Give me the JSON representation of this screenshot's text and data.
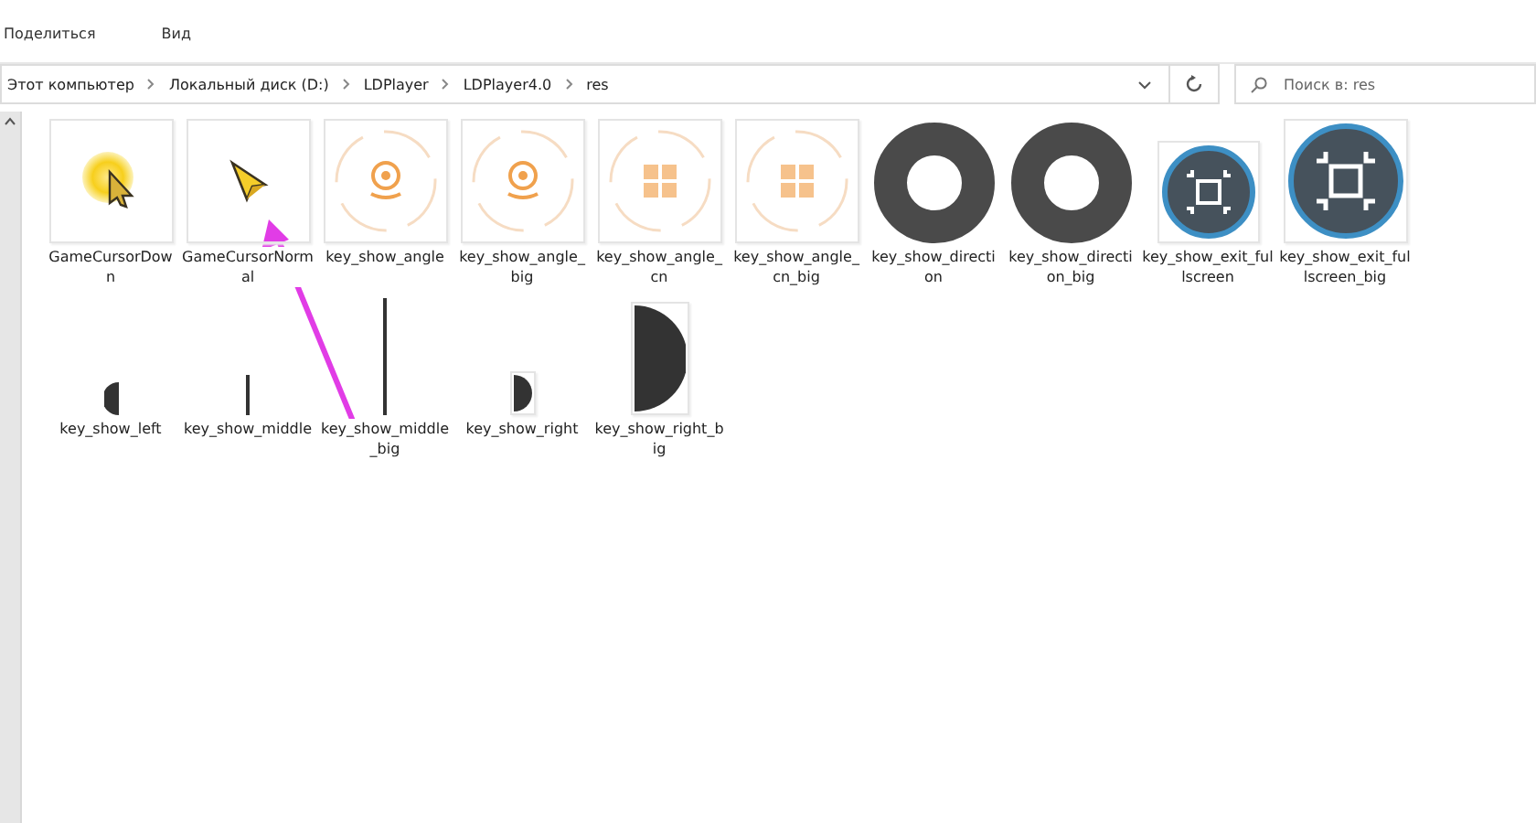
{
  "menu": [
    "Поделиться",
    "Вид"
  ],
  "breadcrumb": [
    "Этот компьютер",
    "Локальный диск (D:)",
    "LDPlayer",
    "LDPlayer4.0",
    "res"
  ],
  "search": {
    "placeholder": "Поиск в: res"
  },
  "files": [
    {
      "name": "GameCursorDown",
      "kind": "cursor-down"
    },
    {
      "name": "GameCursorNormal",
      "kind": "cursor"
    },
    {
      "name": "key_show_angle",
      "kind": "angle"
    },
    {
      "name": "key_show_angle_big",
      "kind": "angle"
    },
    {
      "name": "key_show_angle_cn",
      "kind": "angle-cn"
    },
    {
      "name": "key_show_angle_cn_big",
      "kind": "angle-cn"
    },
    {
      "name": "key_show_direction",
      "kind": "direction"
    },
    {
      "name": "key_show_direction_big",
      "kind": "direction"
    },
    {
      "name": "key_show_exit_fullscreen",
      "kind": "fullscreen"
    },
    {
      "name": "key_show_exit_fullscreen_big",
      "kind": "fullscreen-big"
    },
    {
      "name": "key_show_left",
      "kind": "left"
    },
    {
      "name": "key_show_middle",
      "kind": "middle"
    },
    {
      "name": "key_show_middle_big",
      "kind": "middle-big"
    },
    {
      "name": "key_show_right",
      "kind": "right"
    },
    {
      "name": "key_show_right_big",
      "kind": "right-big"
    }
  ]
}
